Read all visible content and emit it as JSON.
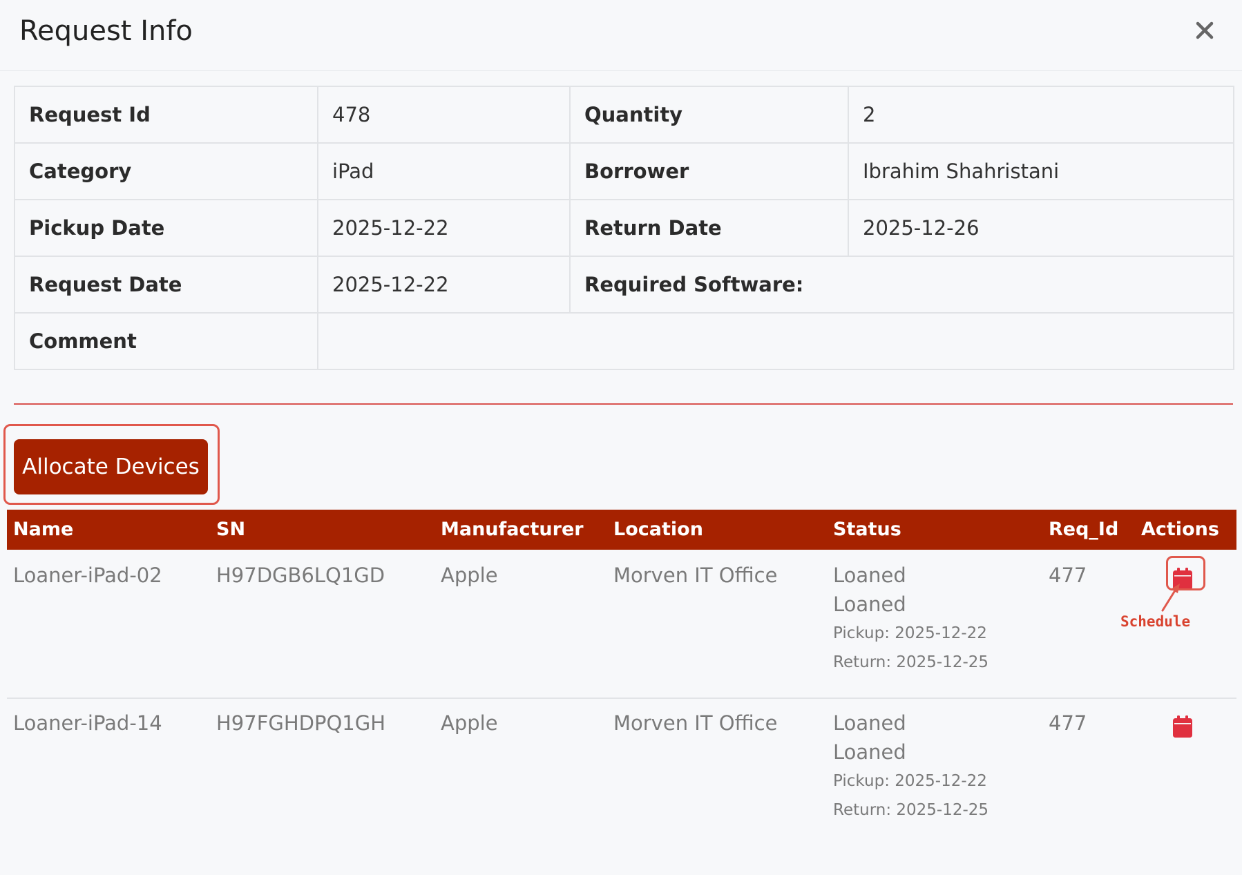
{
  "modal": {
    "title": "Request Info",
    "close_label": "×"
  },
  "info": {
    "request_id_label": "Request Id",
    "request_id": "478",
    "quantity_label": "Quantity",
    "quantity": "2",
    "category_label": "Category",
    "category": "iPad",
    "borrower_label": "Borrower",
    "borrower": "Ibrahim Shahristani",
    "pickup_label": "Pickup Date",
    "pickup": "2025-12-22",
    "return_label": "Return Date",
    "return": "2025-12-26",
    "request_date_label": "Request Date",
    "request_date": "2025-12-22",
    "software_label": "Required Software:",
    "software": "",
    "comment_label": "Comment",
    "comment": ""
  },
  "allocate": {
    "label": "Allocate Devices"
  },
  "devices": {
    "columns": [
      "Name",
      "SN",
      "Manufacturer",
      "Location",
      "Status",
      "Req_Id",
      "Actions"
    ],
    "rows": [
      {
        "name": "Loaner-iPad-02",
        "sn": "H97DGB6LQ1GD",
        "manufacturer": "Apple",
        "location": "Morven IT Office",
        "status": [
          "Loaned",
          "Loaned"
        ],
        "pickup": "Pickup: 2025-12-22",
        "return": "Return: 2025-12-25",
        "req_id": "477",
        "action_icon": "calendar-icon"
      },
      {
        "name": "Loaner-iPad-14",
        "sn": "H97FGHDPQ1GH",
        "manufacturer": "Apple",
        "location": "Morven IT Office",
        "status": [
          "Loaned",
          "Loaned"
        ],
        "pickup": "Pickup: 2025-12-22",
        "return": "Return: 2025-12-25",
        "req_id": "477",
        "action_icon": "calendar-icon"
      }
    ]
  },
  "annotation": {
    "label": "Schedule"
  },
  "colors": {
    "brand": "#a62200",
    "icon": "#e0303f",
    "annotation": "#e0584c",
    "divider": "#d9534f"
  }
}
